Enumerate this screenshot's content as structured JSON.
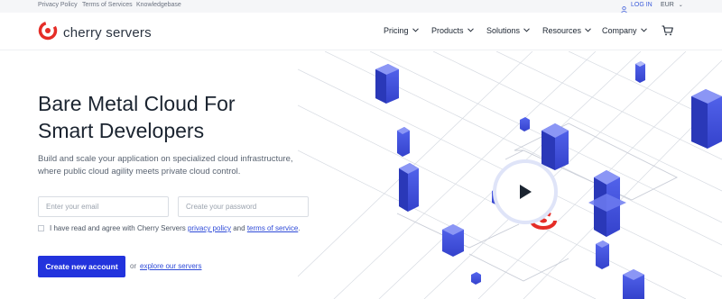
{
  "utility": {
    "links": [
      "Privacy Policy",
      "Terms of Services",
      "Knowledgebase"
    ],
    "login": "LOG IN",
    "currency": "EUR"
  },
  "header": {
    "brand": "cherry servers",
    "nav": [
      "Pricing",
      "Products",
      "Solutions",
      "Resources",
      "Company"
    ]
  },
  "hero": {
    "title_line1": "Bare Metal Cloud For",
    "title_line2": "Smart Developers",
    "subtitle_line1": "Build and scale your application on specialized cloud infrastructure,",
    "subtitle_line2": "where public cloud agility meets private cloud control.",
    "email_placeholder": "Enter your email",
    "password_placeholder": "Create your password",
    "agree_prefix": "I have read and agree with Cherry Servers",
    "privacy_link": "privacy policy",
    "agree_and": "and",
    "terms_link": "terms of service",
    "agree_suffix": ".",
    "cta": "Create new account",
    "or": "or",
    "explore": "explore our servers"
  },
  "colors": {
    "brand_red": "#e52d27",
    "primary_blue": "#2233dd",
    "link_blue": "#2f4bd8",
    "server_blue": "#3f4fd8"
  },
  "icons": [
    "user-icon",
    "chevron-down-icon",
    "cart-icon",
    "play-icon",
    "cherry-logo-icon"
  ]
}
